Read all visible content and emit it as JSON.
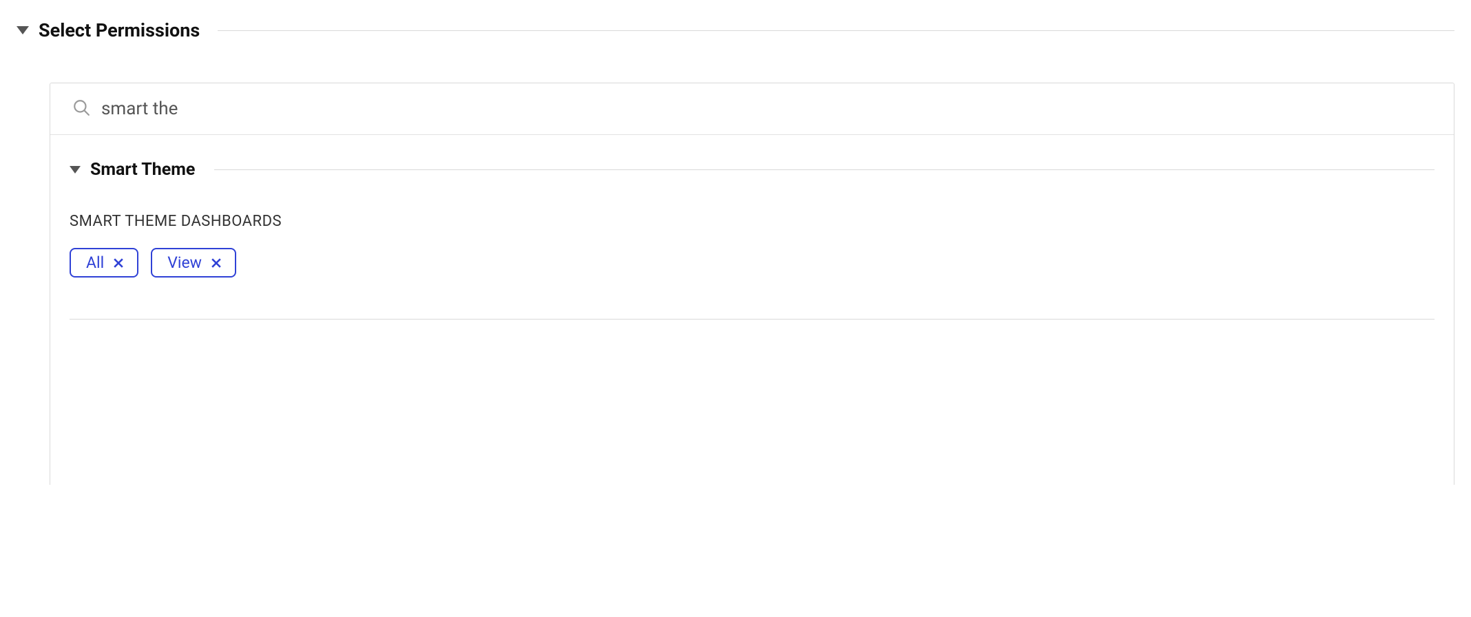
{
  "section": {
    "title": "Select Permissions"
  },
  "search": {
    "value": "smart the",
    "placeholder": ""
  },
  "group": {
    "title": "Smart Theme",
    "subsections": [
      {
        "label": "SMART THEME DASHBOARDS",
        "chips": [
          {
            "label": "All"
          },
          {
            "label": "View"
          }
        ]
      }
    ]
  }
}
